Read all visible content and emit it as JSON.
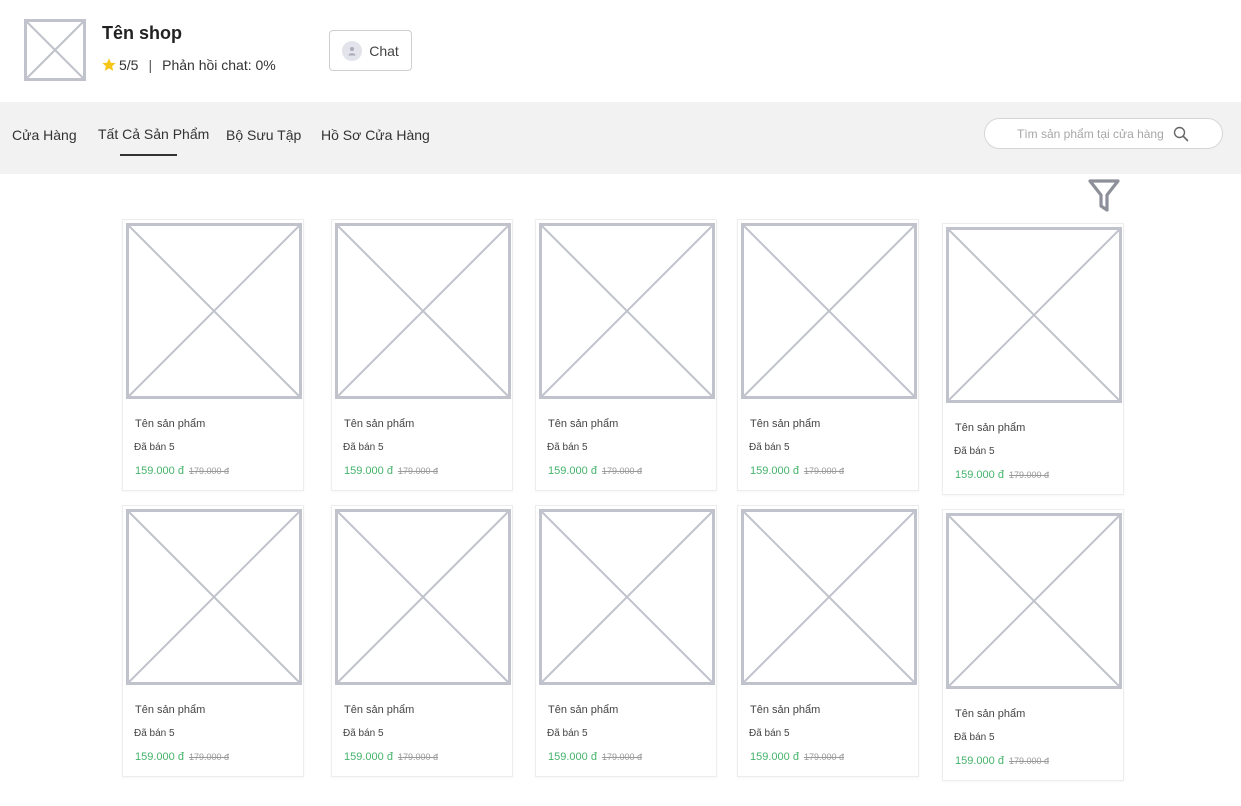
{
  "shop": {
    "name": "Tên shop",
    "rating": "5/5",
    "separator": "|",
    "response": "Phản hồi chat: 0%",
    "chat_label": "Chat"
  },
  "nav": {
    "items": [
      {
        "label": "Cửa Hàng",
        "active": false
      },
      {
        "label": "Tất Cả Sản Phẩm",
        "active": true
      },
      {
        "label": "Bộ Sưu Tập",
        "active": false
      },
      {
        "label": "Hồ Sơ Cửa Hàng",
        "active": false
      }
    ]
  },
  "search": {
    "placeholder": "Tìm sản phẩm tại cửa hàng",
    "value": ""
  },
  "products": [
    {
      "name": "Tên sản phẩm",
      "sold": "Đã bán 5",
      "price": "159.000 đ",
      "old_price": "179.000 đ"
    },
    {
      "name": "Tên sản phẩm",
      "sold": "Đã bán 5",
      "price": "159.000 đ",
      "old_price": "179.000 đ"
    },
    {
      "name": "Tên sản phẩm",
      "sold": "Đã bán 5",
      "price": "159.000 đ",
      "old_price": "179.000 đ"
    },
    {
      "name": "Tên sản phẩm",
      "sold": "Đã bán 5",
      "price": "159.000 đ",
      "old_price": "179.000 đ"
    },
    {
      "name": "Tên sản phẩm",
      "sold": "Đã bán 5",
      "price": "159.000 đ",
      "old_price": "179.000 đ"
    },
    {
      "name": "Tên sản phẩm",
      "sold": "Đã bán 5",
      "price": "159.000 đ",
      "old_price": "179.000 đ"
    },
    {
      "name": "Tên sản phẩm",
      "sold": "Đã bán 5",
      "price": "159.000 đ",
      "old_price": "179.000 đ"
    },
    {
      "name": "Tên sản phẩm",
      "sold": "Đã bán 5",
      "price": "159.000 đ",
      "old_price": "179.000 đ"
    },
    {
      "name": "Tên sản phẩm",
      "sold": "Đã bán 5",
      "price": "159.000 đ",
      "old_price": "179.000 đ"
    },
    {
      "name": "Tên sản phẩm",
      "sold": "Đã bán 5",
      "price": "159.000 đ",
      "old_price": "179.000 đ"
    }
  ],
  "icons": {
    "logo": "image-placeholder-icon",
    "rating": "star-icon",
    "chat_avatar": "user-icon",
    "search": "search-icon",
    "filter": "filter-icon",
    "product_image": "image-placeholder-icon"
  },
  "colors": {
    "price": "#45b36b",
    "star": "#f5c518",
    "nav_background": "#f2f2f2",
    "placeholder_stroke": "#c0c3cc"
  }
}
